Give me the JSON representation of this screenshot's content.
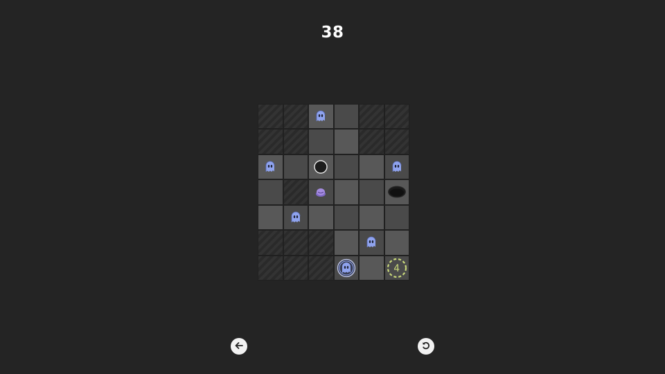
{
  "level": {
    "number": "38"
  },
  "board": {
    "columns": 6,
    "rows": 7,
    "tiles": [
      [
        "hatch",
        "hatch",
        "light",
        "mid",
        "hatch",
        "hatch"
      ],
      [
        "hatch",
        "hatch",
        "mid",
        "light",
        "hatch",
        "hatch"
      ],
      [
        "light",
        "mid",
        "light",
        "mid",
        "light",
        "mid"
      ],
      [
        "mid",
        "hatch",
        "mid",
        "light",
        "mid",
        "light"
      ],
      [
        "light",
        "mid",
        "light",
        "mid",
        "light",
        "mid"
      ],
      [
        "hatch",
        "hatch",
        "hatch",
        "light",
        "mid",
        "light"
      ],
      [
        "hatch",
        "hatch",
        "hatch",
        "mid",
        "light",
        "mid"
      ]
    ],
    "pieces": [
      {
        "type": "ghost",
        "row": 0,
        "col": 2
      },
      {
        "type": "ghost",
        "row": 2,
        "col": 0
      },
      {
        "type": "ball",
        "row": 2,
        "col": 2
      },
      {
        "type": "ghost",
        "row": 2,
        "col": 5
      },
      {
        "type": "slime",
        "row": 3,
        "col": 2
      },
      {
        "type": "pit",
        "row": 3,
        "col": 5
      },
      {
        "type": "ghost",
        "row": 4,
        "col": 1
      },
      {
        "type": "ghost",
        "row": 5,
        "col": 4
      },
      {
        "type": "ghost-ring",
        "row": 6,
        "col": 3
      },
      {
        "type": "goal",
        "row": 6,
        "col": 5,
        "label": "4"
      }
    ]
  },
  "controls": {
    "back_icon": "arrow-left-icon",
    "restart_icon": "restart-icon"
  },
  "colors": {
    "background": "#242424",
    "ghost": "#8fa3ee",
    "slime": "#a58ce0",
    "goal": "#c9d97a"
  }
}
